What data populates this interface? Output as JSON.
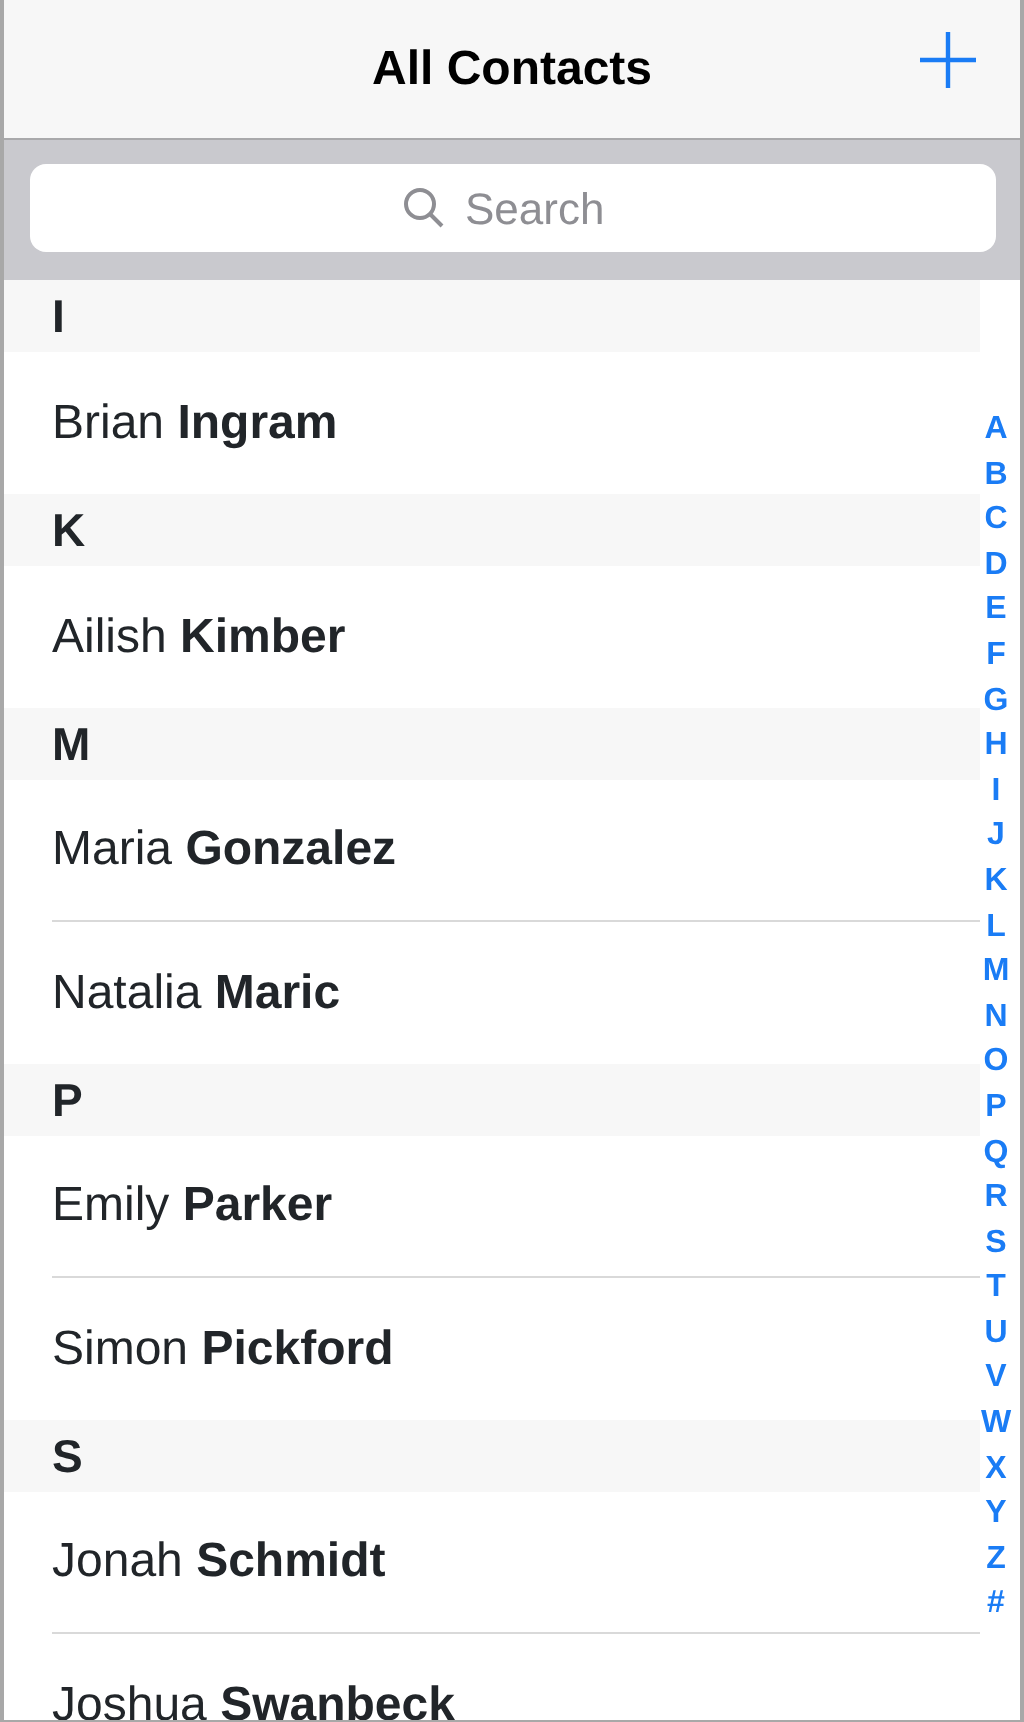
{
  "navbar": {
    "title": "All Contacts"
  },
  "search": {
    "placeholder": "Search"
  },
  "sections": [
    {
      "letter": "I",
      "contacts": [
        {
          "first": "Brian",
          "last": "Ingram"
        }
      ]
    },
    {
      "letter": "K",
      "contacts": [
        {
          "first": "Ailish",
          "last": "Kimber"
        }
      ]
    },
    {
      "letter": "M",
      "contacts": [
        {
          "first": "Maria",
          "last": "Gonzalez"
        },
        {
          "first": "Natalia",
          "last": "Maric"
        }
      ]
    },
    {
      "letter": "P",
      "contacts": [
        {
          "first": "Emily",
          "last": "Parker"
        },
        {
          "first": "Simon",
          "last": "Pickford"
        }
      ]
    },
    {
      "letter": "S",
      "contacts": [
        {
          "first": "Jonah",
          "last": "Schmidt"
        },
        {
          "first": "Joshua",
          "last": "Swanbeck"
        }
      ]
    }
  ],
  "index": [
    "A",
    "B",
    "C",
    "D",
    "E",
    "F",
    "G",
    "H",
    "I",
    "J",
    "K",
    "L",
    "M",
    "N",
    "O",
    "P",
    "Q",
    "R",
    "S",
    "T",
    "U",
    "V",
    "W",
    "X",
    "Y",
    "Z",
    "#"
  ]
}
